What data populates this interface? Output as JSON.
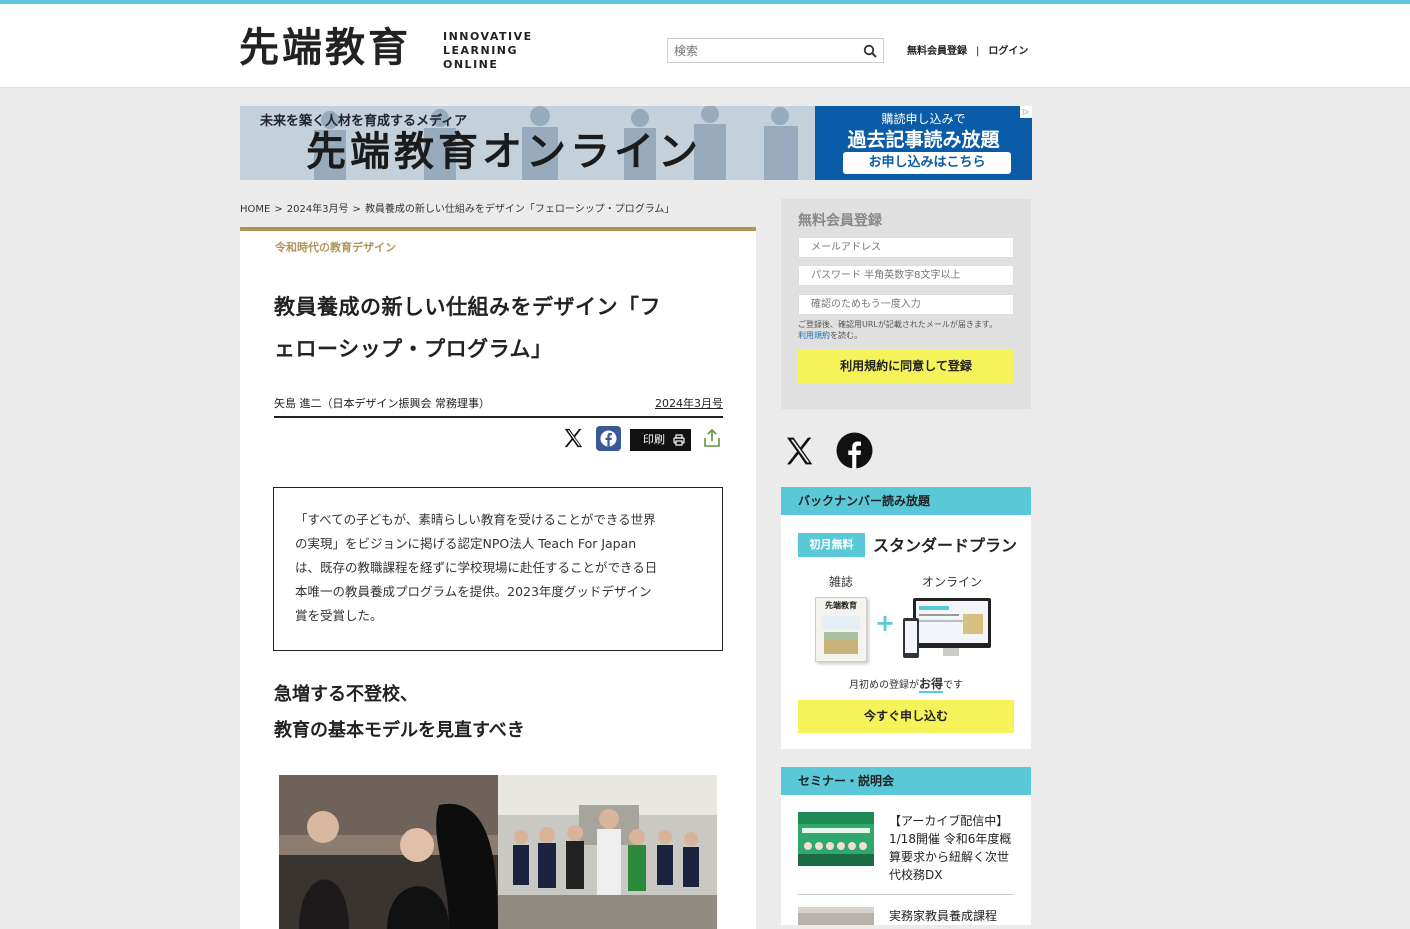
{
  "header": {
    "logo": "先端教育",
    "logo_sub": [
      "INNOVATIVE",
      "LEARNING",
      "ONLINE"
    ],
    "search_placeholder": "検索",
    "register_link": "無料会員登録",
    "separator": "|",
    "login_link": "ログイン"
  },
  "banner": {
    "tagline": "未来を築く人材を育成するメディア",
    "title": "先端教育オンライン",
    "right_line1": "購読申し込みで",
    "right_line2": "過去記事読み放題",
    "button": "お申し込みはこちら"
  },
  "breadcrumb": [
    "HOME",
    ">",
    "2024年3月号",
    ">",
    "教員養成の新しい仕組みをデザイン「フェローシップ・プログラム」"
  ],
  "article": {
    "category": "令和時代の教育デザイン",
    "title_line1": "教員養成の新しい仕組みをデザイン「フ",
    "title_line2": "ェローシップ・プログラム」",
    "author": "矢島 進二（日本デザイン振興会 常務理事）",
    "issue": "2024年3月号",
    "print_label": "印刷",
    "lead_lines": [
      "「すべての子どもが、素晴らしい教育を受けることができる世界",
      "の実現」をビジョンに掲げる認定NPO法人 Teach For Japan",
      "は、既存の教職課程を経ずに学校現場に赴任することができる日",
      "本唯一の教員養成プログラムを提供。2023年度グッドデザイン",
      "賞を受賞した。"
    ],
    "h2_line1": "急増する不登校、",
    "h2_line2": "教育の基本モデルを見直すべき"
  },
  "registration": {
    "title": "無料会員登録",
    "email_placeholder": "メールアドレス",
    "password_placeholder": "パスワード 半角英数字8文字以上",
    "confirm_placeholder": "確認のためもう一度入力",
    "note": "ご登録後、確認用URLが記載されたメールが届きます。",
    "terms_link": "利用規約",
    "terms_suffix": "を読む。",
    "button": "利用規約に同意して登録"
  },
  "backnumber": {
    "heading": "バックナンバー読み放題",
    "badge": "初月無料",
    "plan": "スタンダードプラン",
    "label_magazine": "雑誌",
    "label_online": "オンライン",
    "note_prefix": "月初めの登録が",
    "note_emph": "お得",
    "note_suffix": "です",
    "button": "今すぐ申し込む"
  },
  "seminar": {
    "heading": "セミナー・説明会",
    "items": [
      {
        "text": "【アーカイブ配信中】1/18開催 令和6年度概算要求から紐解く次世代校務DX"
      },
      {
        "text": "実務家教員養成課程"
      }
    ]
  },
  "colors": {
    "accent": "#5bc8d8",
    "gold": "#b0955b",
    "yellow": "#f5f25a",
    "facebook": "#3b5998",
    "banner_blue": "#0a5ba8"
  }
}
